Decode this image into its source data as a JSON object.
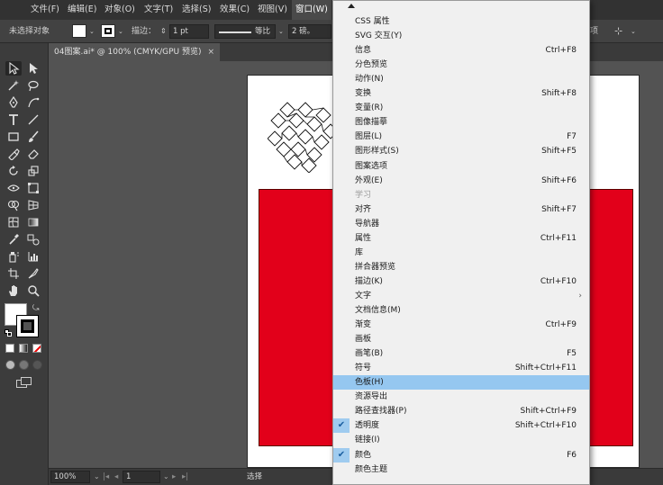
{
  "menubar": {
    "items": [
      "文件(F)",
      "编辑(E)",
      "对象(O)",
      "文字(T)",
      "选择(S)",
      "效果(C)",
      "视图(V)",
      "窗口(W)"
    ]
  },
  "controlbar": {
    "selection_label": "未选择对象",
    "stroke_label": "描边：",
    "stroke_value": "1 pt",
    "stroke_style_label": "等比",
    "dot_value": "2 磅。",
    "right_label": "项"
  },
  "document_tab": {
    "title": "04图案.ai* @ 100% (CMYK/GPU 预览)",
    "close": "×"
  },
  "statusbar": {
    "zoom": "100%",
    "artboard": "1",
    "tool": "选择"
  },
  "window_menu": {
    "items": [
      {
        "label": "CSS 属性",
        "shortcut": "",
        "state": "normal"
      },
      {
        "label": "SVG 交互(Y)",
        "shortcut": "",
        "state": "normal"
      },
      {
        "label": "信息",
        "shortcut": "Ctrl+F8",
        "state": "normal"
      },
      {
        "label": "分色预览",
        "shortcut": "",
        "state": "normal"
      },
      {
        "label": "动作(N)",
        "shortcut": "",
        "state": "normal"
      },
      {
        "label": "变换",
        "shortcut": "Shift+F8",
        "state": "normal"
      },
      {
        "label": "变量(R)",
        "shortcut": "",
        "state": "normal"
      },
      {
        "label": "图像描摹",
        "shortcut": "",
        "state": "normal"
      },
      {
        "label": "图层(L)",
        "shortcut": "F7",
        "state": "normal"
      },
      {
        "label": "图形样式(S)",
        "shortcut": "Shift+F5",
        "state": "normal"
      },
      {
        "label": "图案选项",
        "shortcut": "",
        "state": "normal"
      },
      {
        "label": "外观(E)",
        "shortcut": "Shift+F6",
        "state": "normal"
      },
      {
        "label": "学习",
        "shortcut": "",
        "state": "disabled"
      },
      {
        "label": "对齐",
        "shortcut": "Shift+F7",
        "state": "normal"
      },
      {
        "label": "导航器",
        "shortcut": "",
        "state": "normal"
      },
      {
        "label": "属性",
        "shortcut": "Ctrl+F11",
        "state": "normal"
      },
      {
        "label": "库",
        "shortcut": "",
        "state": "normal"
      },
      {
        "label": "拼合器预览",
        "shortcut": "",
        "state": "normal"
      },
      {
        "label": "描边(K)",
        "shortcut": "Ctrl+F10",
        "state": "normal"
      },
      {
        "label": "文字",
        "shortcut": "",
        "state": "submenu",
        "submenu_glyph": "›"
      },
      {
        "label": "文档信息(M)",
        "shortcut": "",
        "state": "normal"
      },
      {
        "label": "渐变",
        "shortcut": "Ctrl+F9",
        "state": "normal"
      },
      {
        "label": "画板",
        "shortcut": "",
        "state": "normal"
      },
      {
        "label": "画笔(B)",
        "shortcut": "F5",
        "state": "normal"
      },
      {
        "label": "符号",
        "shortcut": "Shift+Ctrl+F11",
        "state": "normal"
      },
      {
        "label": "色板(H)",
        "shortcut": "",
        "state": "highlighted"
      },
      {
        "label": "资源导出",
        "shortcut": "",
        "state": "normal"
      },
      {
        "label": "路径查找器(P)",
        "shortcut": "Shift+Ctrl+F9",
        "state": "normal"
      },
      {
        "label": "透明度",
        "shortcut": "Shift+Ctrl+F10",
        "state": "checked",
        "check_glyph": "✔"
      },
      {
        "label": "链接(I)",
        "shortcut": "",
        "state": "normal"
      },
      {
        "label": "颜色",
        "shortcut": "F6",
        "state": "checked",
        "check_glyph": "✔"
      },
      {
        "label": "颜色主题",
        "shortcut": "",
        "state": "normal"
      }
    ]
  },
  "colors": {
    "menu_highlight": "#95c7f0",
    "artboard_red": "#e2001a",
    "ui_dark": "#323232"
  }
}
